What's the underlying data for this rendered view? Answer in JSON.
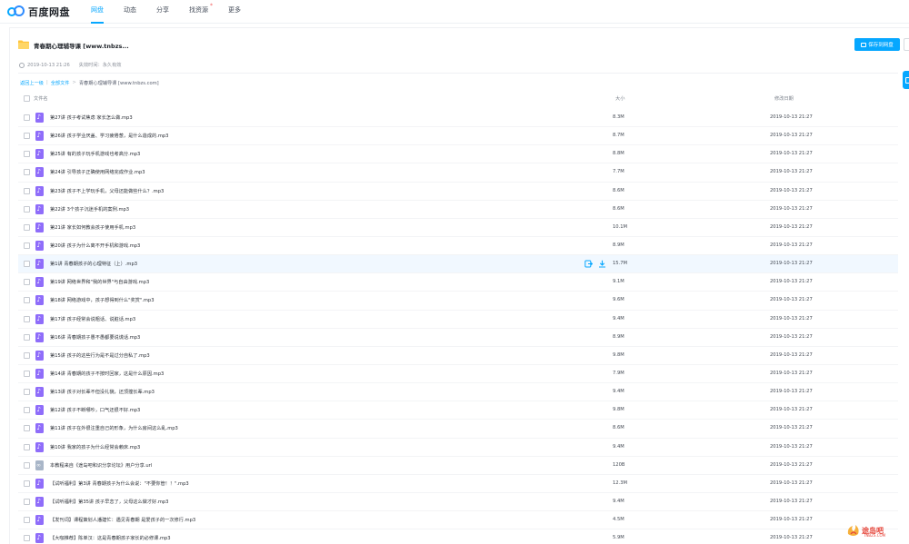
{
  "app": {
    "logo_text": "百度网盘"
  },
  "nav": {
    "items": [
      {
        "label": "网盘",
        "active": true
      },
      {
        "label": "动态",
        "active": false
      },
      {
        "label": "分享",
        "active": false
      },
      {
        "label": "找资源",
        "active": false,
        "badge": "*"
      },
      {
        "label": "更多",
        "active": false
      }
    ]
  },
  "share": {
    "title": "青春期心理辅导课 [www.tnbzs...",
    "save_button": "保存到网盘",
    "created": "2019-10-13 21:26",
    "expire_label": "失效时间：永久有效"
  },
  "breadcrumb": {
    "back": "返回上一级",
    "sep": "|",
    "all_files": "全部文件",
    "arrow": ">",
    "current": "青春期心理辅导课 [www.tnbzs.com]"
  },
  "table": {
    "col_name": "文件名",
    "col_size": "大小",
    "col_date": "修改日期",
    "rows": [
      {
        "name": "第27讲 孩子考试焦虑 家长怎么做.mp3",
        "size": "8.3M",
        "date": "2019-10-13 21:27",
        "type": "audio"
      },
      {
        "name": "第26讲 孩子学业厌盖、学习疲倦葱，是什么造成的.mp3",
        "size": "8.7M",
        "date": "2019-10-13 21:27",
        "type": "audio"
      },
      {
        "name": "第25讲 有的孩子玩手机游戏也考高分.mp3",
        "size": "8.8M",
        "date": "2019-10-13 21:27",
        "type": "audio"
      },
      {
        "name": "第24讲 引导孩子正确使用网络完成作业.mp3",
        "size": "7.7M",
        "date": "2019-10-13 21:27",
        "type": "audio"
      },
      {
        "name": "第23讲 孩子不上学玩手机，父母还能做些什么？.mp3",
        "size": "8.6M",
        "date": "2019-10-13 21:27",
        "type": "audio"
      },
      {
        "name": "第22讲 3个孩子沉迷手机的案例.mp3",
        "size": "8.6M",
        "date": "2019-10-13 21:27",
        "type": "audio"
      },
      {
        "name": "第21讲 家长如何教会孩子使用手机.mp3",
        "size": "10.1M",
        "date": "2019-10-13 21:27",
        "type": "audio"
      },
      {
        "name": "第20讲 孩子为什么离不开手机和游戏.mp3",
        "size": "8.9M",
        "date": "2019-10-13 21:27",
        "type": "audio"
      },
      {
        "name": "第1讲 青春期孩子的心理特征（上）.mp3",
        "size": "15.7M",
        "date": "2019-10-13 21:27",
        "type": "audio",
        "hover": true
      },
      {
        "name": "第19讲 网络世界和\"我的世界\"与自由游戏.mp3",
        "size": "9.1M",
        "date": "2019-10-13 21:27",
        "type": "audio"
      },
      {
        "name": "第18讲 网络游戏中，孩子想得到什么\"奖赏\".mp3",
        "size": "9.6M",
        "date": "2019-10-13 21:27",
        "type": "audio"
      },
      {
        "name": "第17讲 孩子经常会说粗话、说脏话.mp3",
        "size": "9.4M",
        "date": "2019-10-13 21:27",
        "type": "audio"
      },
      {
        "name": "第16讲 青春期孩子愚不愚都要说谎话.mp3",
        "size": "8.9M",
        "date": "2019-10-13 21:27",
        "type": "audio"
      },
      {
        "name": "第15讲 孩子的这些行为是不是过分自私了.mp3",
        "size": "9.8M",
        "date": "2019-10-13 21:27",
        "type": "audio"
      },
      {
        "name": "第14讲 青春期的孩子不按时回家，这是什么原因.mp3",
        "size": "7.9M",
        "date": "2019-10-13 21:27",
        "type": "audio"
      },
      {
        "name": "第13讲 孩子对长辈不但没礼貌，还顶撞长辈.mp3",
        "size": "9.4M",
        "date": "2019-10-13 21:27",
        "type": "audio"
      },
      {
        "name": "第12讲 孩子不断哪吵，口气还很不好.mp3",
        "size": "9.8M",
        "date": "2019-10-13 21:27",
        "type": "audio"
      },
      {
        "name": "第11讲 孩子在外很注重自己的形象，为什么房间这么乱.mp3",
        "size": "8.6M",
        "date": "2019-10-13 21:27",
        "type": "audio"
      },
      {
        "name": "第10讲 我家的孩子为什么经常会赖床.mp3",
        "size": "9.4M",
        "date": "2019-10-13 21:27",
        "type": "audio"
      },
      {
        "name": "本教程来自《途岛吧和识分享论坛》用户分享.url",
        "size": "120B",
        "date": "2019-10-13 21:27",
        "type": "url"
      },
      {
        "name": "【试听福利】第3讲 青春期孩子为什么会说：\"不要你管！！\".mp3",
        "size": "12.3M",
        "date": "2019-10-13 21:27",
        "type": "audio"
      },
      {
        "name": "【试听福利】第35讲 孩子早恋了，父母这么做才好.mp3",
        "size": "9.4M",
        "date": "2019-10-13 21:27",
        "type": "audio"
      },
      {
        "name": "【发刊词】课程策划人潘建忙：遇见青春期 是爱孩子的一次修行.mp3",
        "size": "4.5M",
        "date": "2019-10-13 21:27",
        "type": "audio"
      },
      {
        "name": "【大咖推荐】陈单汉：这是青春期孩子家长的必修课.mp3",
        "size": "5.9M",
        "date": "2019-10-13 21:27",
        "type": "audio"
      }
    ]
  },
  "watermark": {
    "text": "途岛吧",
    "sub": "TNBZS.COM"
  },
  "colors": {
    "accent": "#06a7ff",
    "audio_icon": "#8f6dfa",
    "hover_row": "#f1f8ff"
  }
}
